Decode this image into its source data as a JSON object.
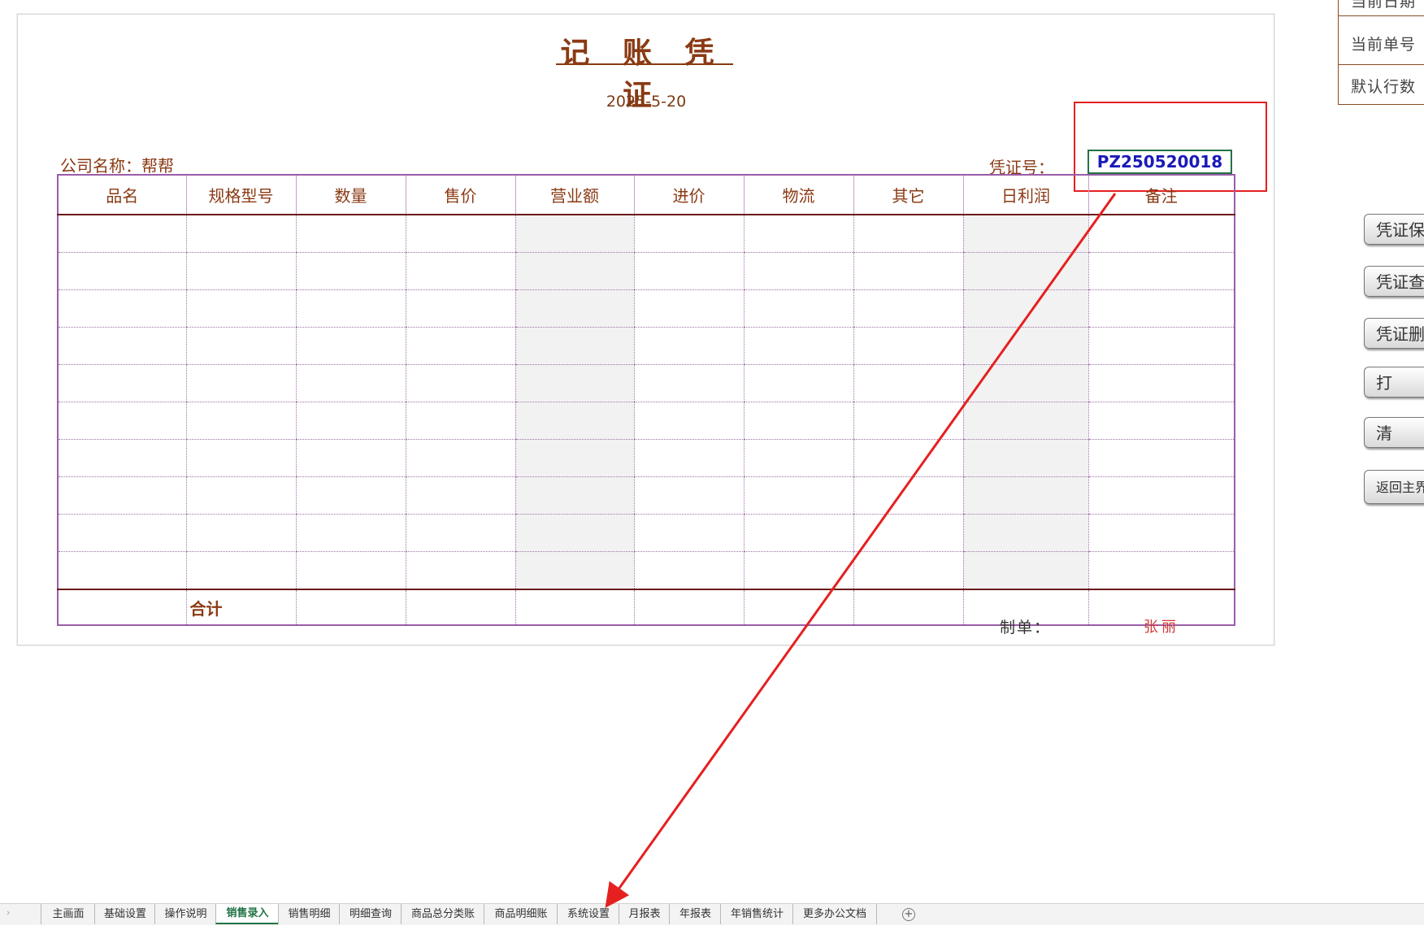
{
  "voucher": {
    "title": "记 账 凭 证",
    "date": "2025-5-20",
    "company_label": "公司名称：",
    "company_name": "帮帮",
    "voucher_no_label": "凭证号：",
    "voucher_no": "PZ250520018",
    "columns": [
      "品名",
      "规格型号",
      "数量",
      "售价",
      "营业额",
      "进价",
      "物流",
      "其它",
      "日利润",
      "备注"
    ],
    "total_label": "合计",
    "maker_label": "制单：",
    "maker_name": "张丽"
  },
  "info_panel": {
    "current_date": "当前日期",
    "current_no": "当前单号",
    "default_rows": "默认行数"
  },
  "side_buttons": [
    {
      "label": "凭证保"
    },
    {
      "label": "凭证查"
    },
    {
      "label": "凭证删"
    },
    {
      "label": "打"
    },
    {
      "label": "清"
    },
    {
      "label": "返回主界"
    }
  ],
  "sheet_tabs": [
    "主画面",
    "基础设置",
    "操作说明",
    "销售录入",
    "销售明细",
    "明细查询",
    "商品总分类账",
    "商品明细账",
    "系统设置",
    "月报表",
    "年报表",
    "年销售统计",
    "更多办公文档"
  ],
  "active_tab": "销售录入",
  "colors": {
    "title_brown": "#8a3a14",
    "grid_purple": "#9b5ca8",
    "voucher_blue": "#1a1ab8",
    "highlight_red": "#e62020",
    "excel_green": "#217346"
  }
}
